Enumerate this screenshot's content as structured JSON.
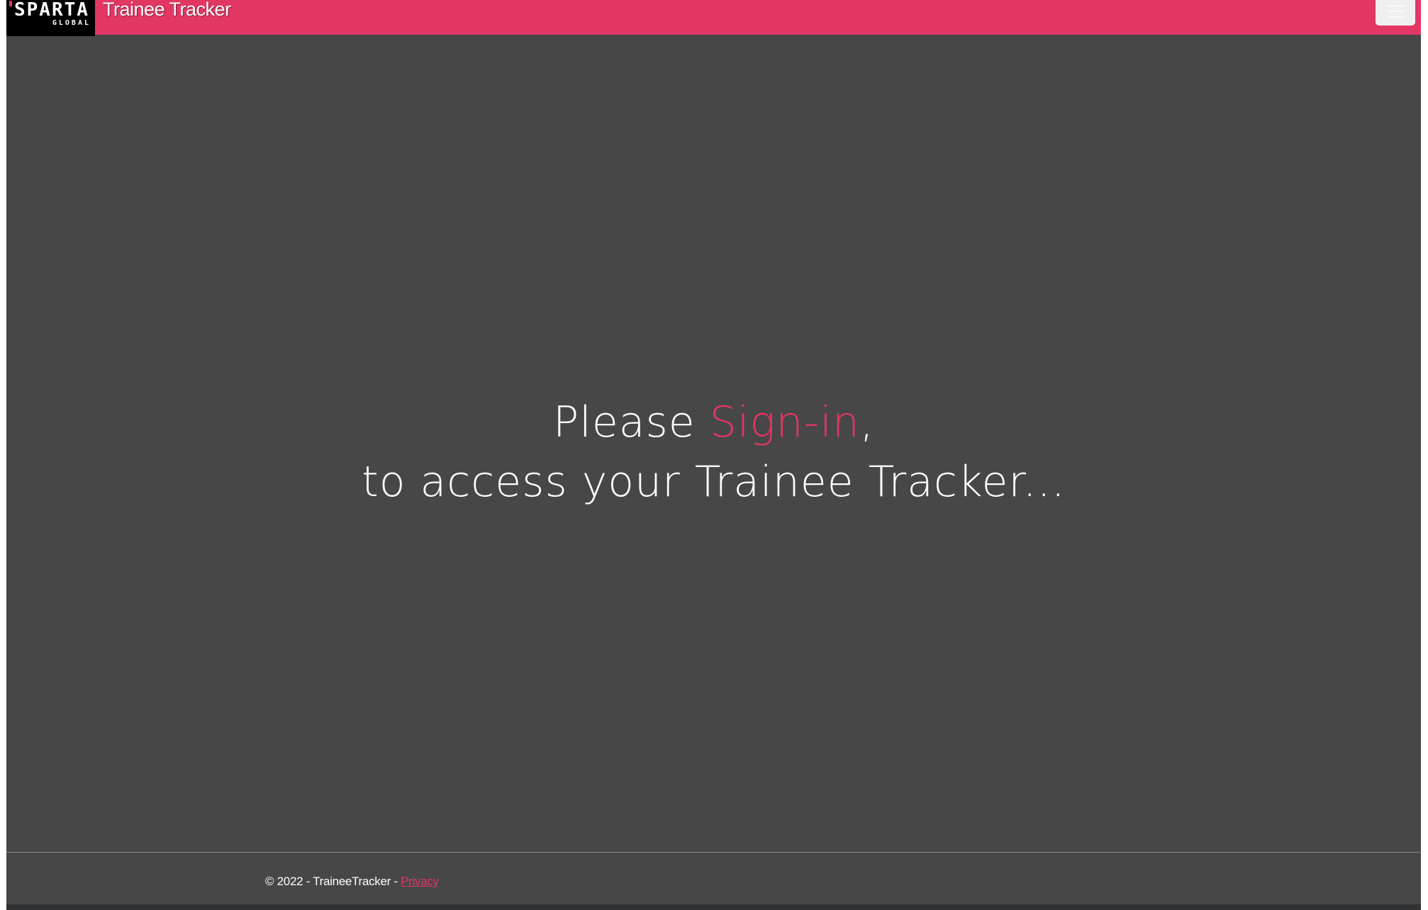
{
  "header": {
    "logo": {
      "main": "SPARTA",
      "sub": "GLOBAL"
    },
    "title": "Trainee Tracker",
    "menu_icon": "hamburger-icon"
  },
  "main": {
    "line1_prefix": "Please ",
    "line1_link": "Sign-in",
    "line1_suffix": ",",
    "line2": "to access your Trainee Tracker..."
  },
  "footer": {
    "copyright": "© 2022 - TraineeTracker - ",
    "privacy_link": "Privacy"
  },
  "colors": {
    "accent": "#e23663",
    "background": "#474747",
    "logo_background": "#000000",
    "text": "#ffffff"
  }
}
